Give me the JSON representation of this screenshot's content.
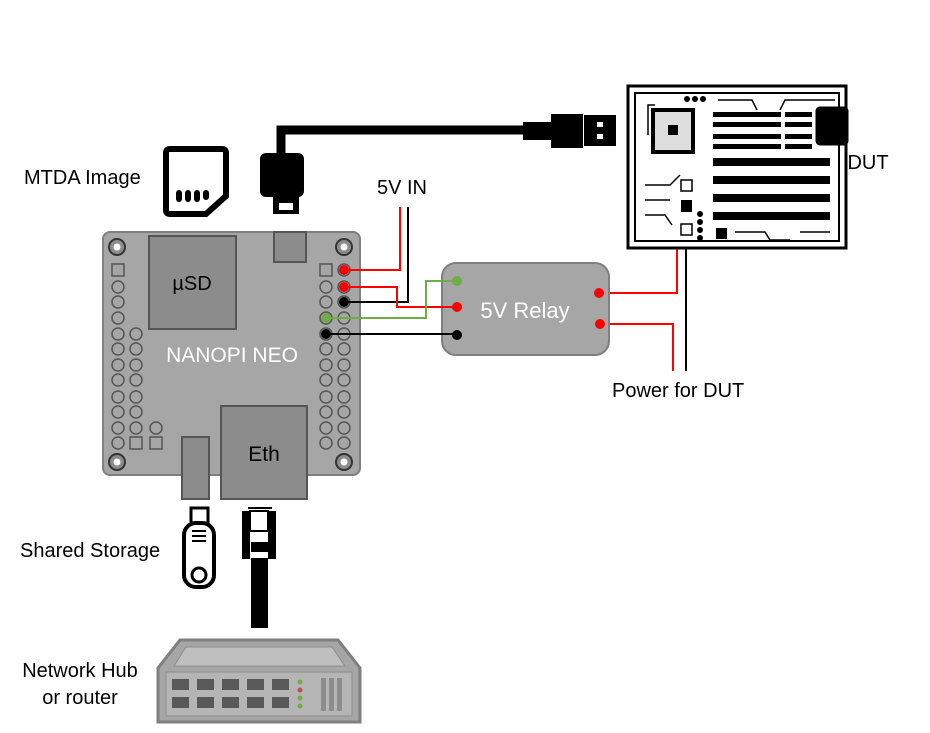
{
  "labels": {
    "mtda_image": "MTDA Image",
    "five_v_in": "5V IN",
    "dut": "DUT",
    "power_for_dut": "Power for DUT",
    "shared_storage": "Shared Storage",
    "network_hub_line1": "Network Hub",
    "network_hub_line2": "or router"
  },
  "board": {
    "name": "NANOPI NEO",
    "usd": "µSD",
    "eth": "Eth"
  },
  "relay": {
    "name": "5V Relay"
  },
  "colors": {
    "power": "#ff0000",
    "ground": "#000000",
    "signal": "#70ad47",
    "board": "#a6a6a6"
  }
}
